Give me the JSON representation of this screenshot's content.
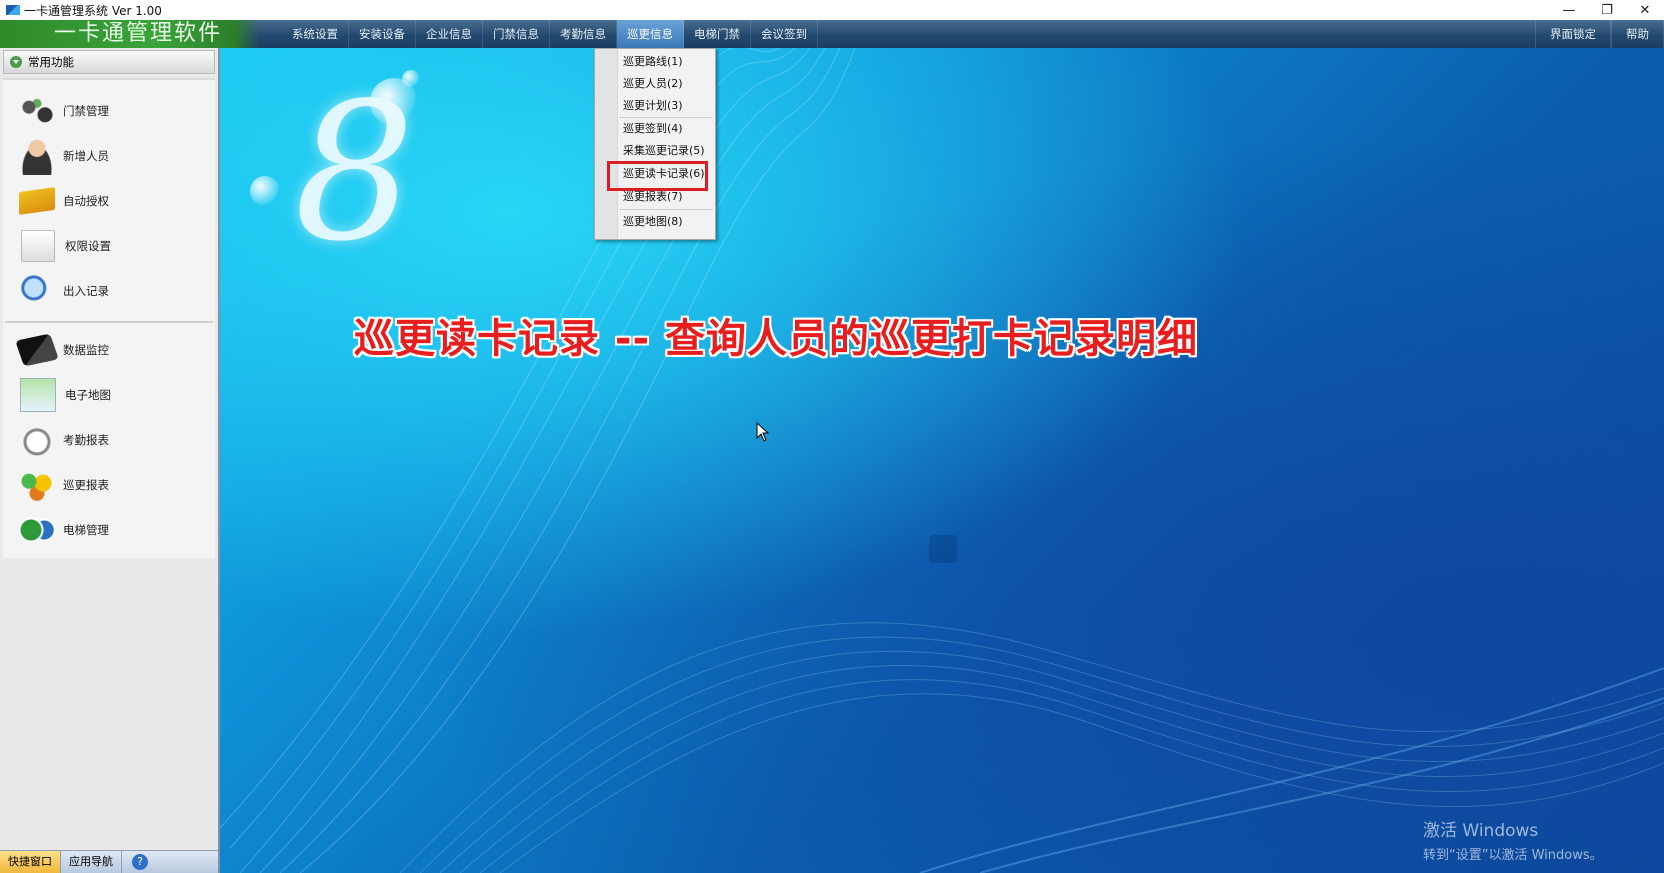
{
  "window": {
    "title": "一卡通管理系统  Ver 1.00",
    "controls": [
      "—",
      "❐",
      "✕"
    ]
  },
  "menubar": {
    "brand": "一卡通管理软件",
    "items": [
      "系统设置",
      "安装设备",
      "企业信息",
      "门禁信息",
      "考勤信息",
      "巡更信息",
      "电梯门禁",
      "会议签到"
    ],
    "active_item": "巡更信息",
    "right_items": [
      "界面锁定",
      "帮助"
    ]
  },
  "dropdown": {
    "items": [
      "巡更路线(1)",
      "巡更人员(2)",
      "巡更计划(3)",
      "巡更签到(4)",
      "采集巡更记录(5)",
      "巡更读卡记录(6)",
      "巡更报表(7)",
      "巡更地图(8)"
    ],
    "highlighted": "巡更读卡记录(6)"
  },
  "sidebar": {
    "header": "常用功能",
    "items": [
      {
        "label": "门禁管理",
        "icon": "door-control-icon"
      },
      {
        "label": "新增人员",
        "icon": "person-icon"
      },
      {
        "label": "自动授权",
        "icon": "card-icon"
      },
      {
        "label": "权限设置",
        "icon": "permission-icon"
      },
      {
        "label": "出入记录",
        "icon": "search-record-icon"
      },
      {
        "label": "数据监控",
        "icon": "camera-icon"
      },
      {
        "label": "电子地图",
        "icon": "map-icon"
      },
      {
        "label": "考勤报表",
        "icon": "clock-icon"
      },
      {
        "label": "巡更报表",
        "icon": "patrol-report-icon"
      },
      {
        "label": "电梯管理",
        "icon": "elevator-icon"
      }
    ],
    "bottom_tabs": [
      "快捷窗口",
      "应用导航"
    ],
    "help": "?"
  },
  "main": {
    "logo": "8",
    "annotation": "巡更读卡记录 -- 查询人员的巡更打卡记录明细",
    "activation_line1": "激活 Windows",
    "activation_line2": "转到“设置”以激活 Windows。"
  }
}
